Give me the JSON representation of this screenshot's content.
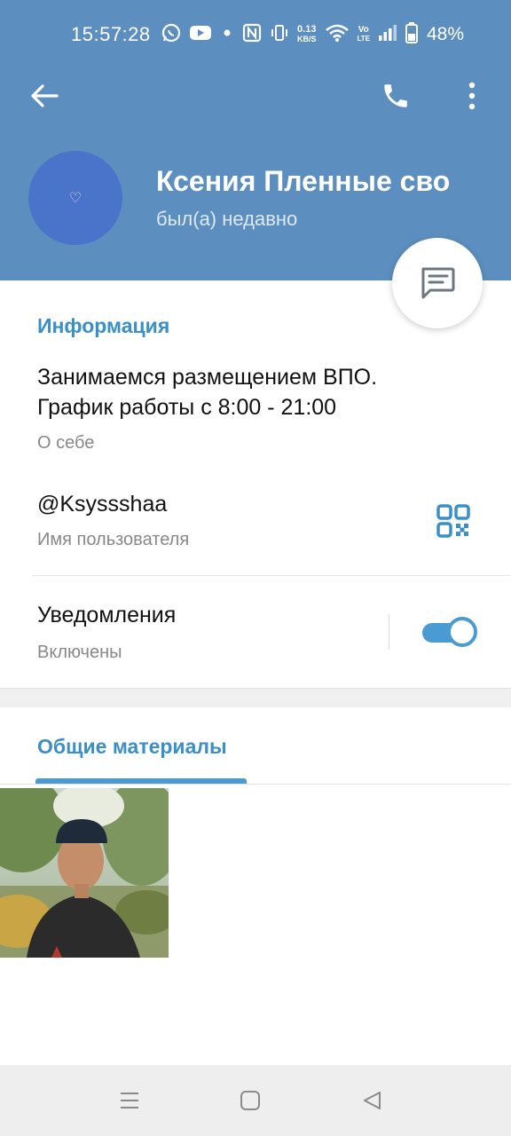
{
  "status_bar": {
    "time": "15:57:28",
    "net_speed_top": "0.13",
    "net_speed_bottom": "KB/S",
    "volte_top": "Vo",
    "volte_bottom": "LTE",
    "battery": "48%",
    "icons": [
      "whatsapp-icon",
      "youtube-icon",
      "dot-icon",
      "nfc-icon",
      "vibrate-icon",
      "wifi-icon",
      "volte-icon",
      "signal-icon",
      "battery-icon"
    ]
  },
  "toolbar": {
    "back_icon": "arrow-left-icon",
    "call_icon": "phone-icon",
    "more_icon": "more-vertical-icon"
  },
  "profile": {
    "avatar_glyph": "♡",
    "name": "Ксения Пленные сво",
    "status": "был(а) недавно",
    "message_icon": "message-icon"
  },
  "info": {
    "title": "Информация",
    "bio": "Занимаемся размещением ВПО. График работы с 8:00 - 21:00",
    "bio_label": "О себе",
    "username": "@Ksyssshaa",
    "username_label": "Имя пользователя",
    "qr_icon": "qr-code-icon",
    "notifications": "Уведомления",
    "notifications_status": "Включены",
    "notifications_on": true
  },
  "media": {
    "title": "Общие материалы",
    "items": [
      {
        "type": "photo"
      }
    ]
  },
  "nav_bar": {
    "buttons": [
      "menu-icon",
      "home-icon",
      "back-triangle-icon"
    ]
  },
  "colors": {
    "header": "#5c8fbf",
    "accent": "#3a8fc9",
    "avatar": "#4a74c9"
  }
}
